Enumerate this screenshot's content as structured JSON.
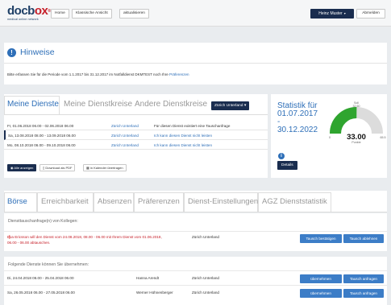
{
  "header": {
    "logo_main": "docb",
    "logo_ox": "ox",
    "logo_reg": "®",
    "logo_sub": "medical online network",
    "nav": [
      "Home",
      "Klassische Ansicht",
      "aktualisieren"
    ],
    "user_label": "Heinz Muster",
    "logout_label": "Abmelden"
  },
  "hinweise": {
    "title": "Hinweise",
    "text": "Bitte erfassen Sie für die Periode vom 1.1.2017 bis 31.12.2017 im Notfalldienst DKMTEST noch Ihre",
    "link": "Präferenzen"
  },
  "dienste": {
    "tabs": [
      "Meine Dienste",
      "Meine Dienstkreise",
      "Andere Dienstkreise"
    ],
    "filter_label": "Zürich Unterland",
    "rows": [
      {
        "date": "Fr, 01.06.2018 06.00 - 02.06.2018 06.00",
        "kreis": "Zürich Unterland",
        "note": "Für diesen Dienst existiert eine Tauschanfrage",
        "note_link": false
      },
      {
        "date": "Sa, 13.08.2018 08.00 - 13.09.2018 06.00",
        "kreis": "Zürich Unterland",
        "note": "Ich kann diesen Dienst nicht leisten",
        "note_link": true
      },
      {
        "date": "Mo, 08.10.2018 06.00 - 09.10.2018 06.00",
        "kreis": "Zürich Unterland",
        "note": "Ich kann diesen Dienst nicht leisten",
        "note_link": true
      }
    ],
    "btn_all": "Alle anzeigen",
    "btn_pdf": "Download als PDF",
    "btn_cal": "in Kalender übertragen"
  },
  "statistik": {
    "title": "Statistik für",
    "from": "01.07.2017",
    "dash": "-",
    "to": "30.12.2022",
    "details_label": "Details",
    "gauge": {
      "value": 33.0,
      "value_label": "33.00",
      "min_label": "0",
      "max_label": "65.5",
      "target_label": "Soll",
      "target_value_label": "32.60",
      "unit_label": "Punkte",
      "min": 0,
      "max": 65.5,
      "target": 32.6,
      "fill_color": "#2fa52f",
      "rest_color": "#dcdcdc"
    }
  },
  "tabs2": [
    "Börse",
    "Erreichbarkeit",
    "Absenzen",
    "Präferenzen",
    "Dienst-Einstellungen",
    "AGZ Dienststatistik"
  ],
  "tausch": {
    "heading": "Diensttauschanfrage(n) von Kollegen:",
    "text_line1": "Eva Ericsson will den Dienst vom 24.08.2018, 08.00 - 06.00 mit Ihrem Dienst vom 01.06.2018,",
    "text_line2": "06.00 - 06.00 abtauschen.",
    "kreis": "Zürich Unterland",
    "btn_accept": "Tausch bestätigen",
    "btn_reject": "Tausch ablehnen"
  },
  "uebernehmen": {
    "heading": "Folgende Dienste können Sie übernehmen:",
    "rows": [
      {
        "date": "Di, 24.04.2018 06.00 - 25.04.2018 06.00",
        "name": "Hanna Arendt",
        "kreis": "Zürich Unterland"
      },
      {
        "date": "Sa, 26.05.2018 06.00 - 27.05.2018 06.00",
        "name": "Werner Hühnenberger",
        "kreis": "Zürich Unterland"
      }
    ],
    "btn_take": "übernehmen",
    "btn_request": "Tausch anfragen"
  }
}
